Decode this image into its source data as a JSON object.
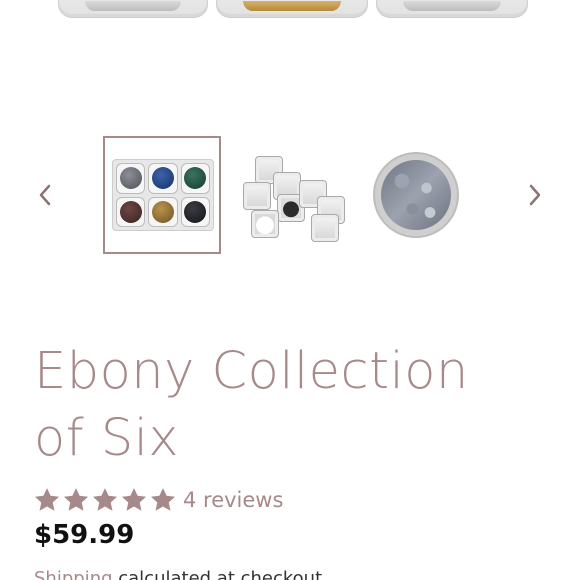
{
  "product": {
    "title_line1": "Ebony Collection",
    "title_line2": "of Six",
    "reviews_text": "4 reviews",
    "price": "$59.99",
    "shipping_link": "Shipping",
    "shipping_rest": " calculated at checkout.",
    "rating": 5,
    "max_rating": 5
  },
  "carousel": {
    "prev_icon": "chevron-left-icon",
    "next_icon": "chevron-right-icon",
    "selected_index": 0,
    "thumbnails": [
      {
        "name": "six-jar-palette",
        "colors": [
          "#5b5e63",
          "#1f3f7a",
          "#1f4a3a",
          "#4a2d2c",
          "#8a6a2f",
          "#1a1b1f"
        ]
      },
      {
        "name": "scattered-jars"
      },
      {
        "name": "silver-glitter-jar"
      }
    ]
  },
  "colors": {
    "accent": "#a7898a",
    "price": "#111111",
    "arrow": "#8e7374"
  }
}
